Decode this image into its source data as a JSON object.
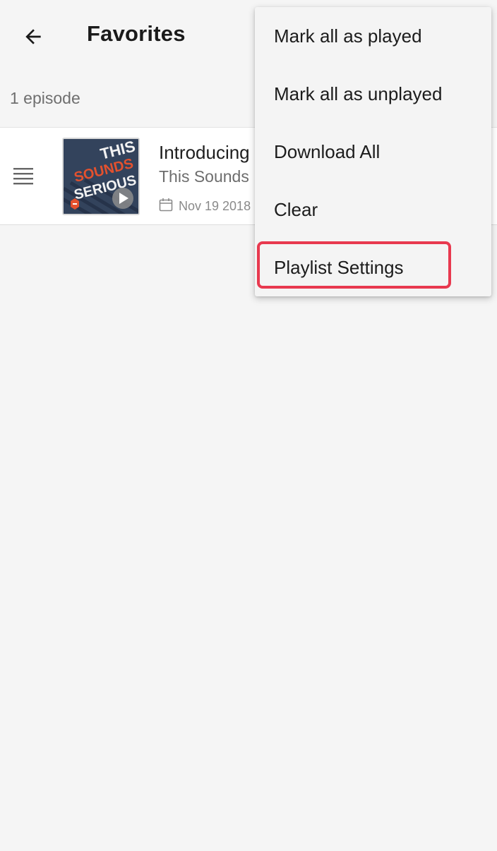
{
  "appbar": {
    "title": "Favorites",
    "back_icon": "arrow-back-icon"
  },
  "list": {
    "episode_count": "1 episode"
  },
  "episode": {
    "title": "Introducing",
    "podcast": "This Sounds",
    "date": "Nov 19 2018",
    "artwork": {
      "line1": "THIS",
      "line2": "SOUNDS",
      "line3": "SERIOUS"
    }
  },
  "menu": {
    "items": [
      {
        "label": "Mark all as played"
      },
      {
        "label": "Mark all as unplayed"
      },
      {
        "label": "Download All"
      },
      {
        "label": "Clear"
      },
      {
        "label": "Playlist Settings",
        "highlighted": true
      }
    ]
  },
  "colors": {
    "background": "#f5f5f5",
    "highlight": "#e8394f",
    "artwork_bg": "#33435c",
    "artwork_accent": "#e4512e"
  }
}
